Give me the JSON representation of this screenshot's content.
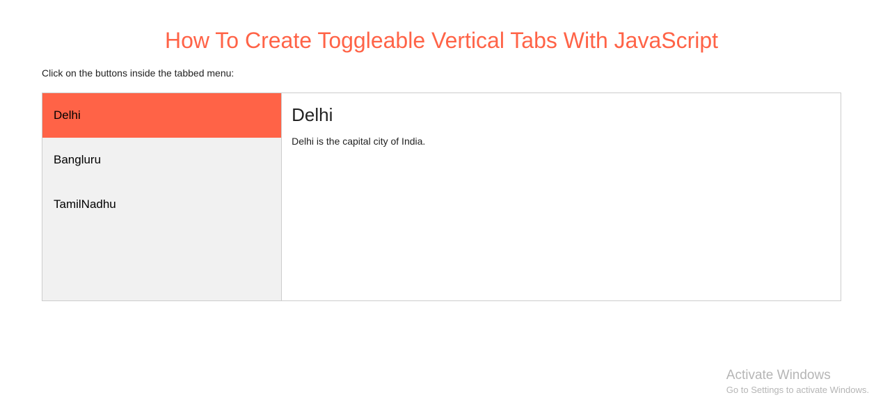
{
  "page": {
    "title": "How To Create Toggleable Vertical Tabs With JavaScript",
    "instruction": "Click on the buttons inside the tabbed menu:"
  },
  "tabs": {
    "items": [
      {
        "label": "Delhi",
        "active": true
      },
      {
        "label": "Bangluru",
        "active": false
      },
      {
        "label": "TamilNadhu",
        "active": false
      }
    ]
  },
  "content": {
    "heading": "Delhi",
    "body": "Delhi is the capital city of India."
  },
  "watermark": {
    "title": "Activate Windows",
    "subtitle": "Go to Settings to activate Windows."
  }
}
